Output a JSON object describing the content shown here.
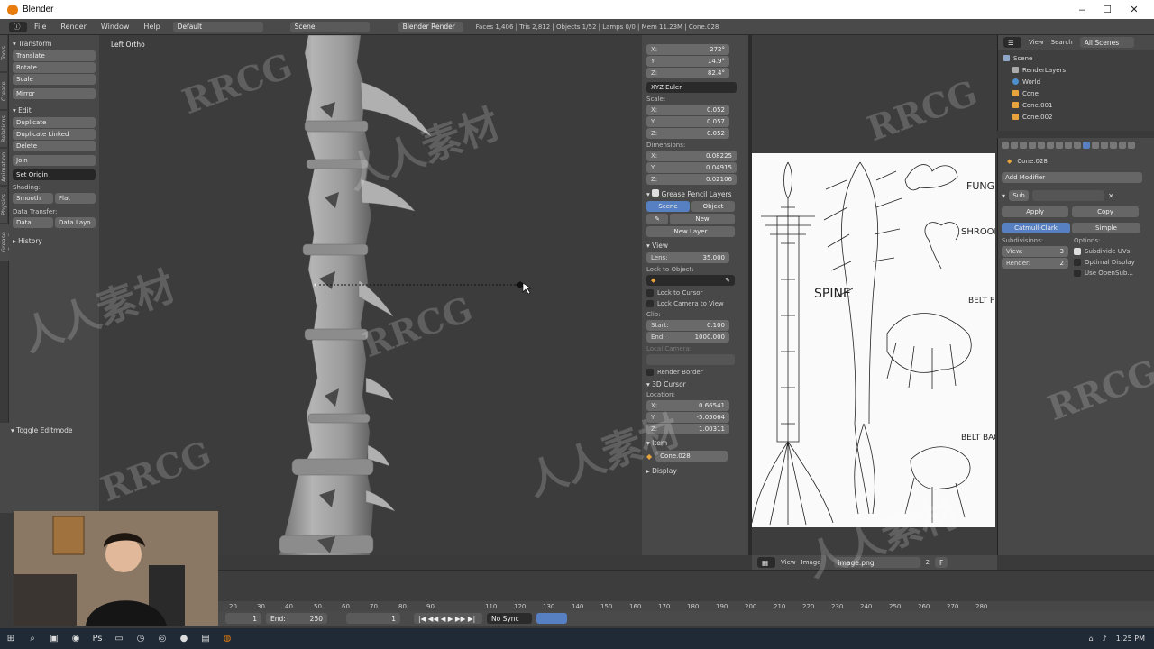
{
  "window": {
    "title": "Blender",
    "controls": [
      "–",
      "☐",
      "✕"
    ]
  },
  "menubar": {
    "items": [
      "File",
      "Render",
      "Window",
      "Help"
    ],
    "layout": "Default",
    "scene": "Scene",
    "engine": "Blender Render",
    "stats": "Faces 1,406 | Tris 2,812 | Objects 1/52 | Lamps 0/0 | Mem 11.23M | Cone.028"
  },
  "tool_tabs": [
    "Tools",
    "Create",
    "Relations",
    "Animation",
    "Physics",
    "Grease Pencil"
  ],
  "toolshelf": {
    "transform": {
      "header": "Transform",
      "buttons": [
        "Translate",
        "Rotate",
        "Scale",
        "Mirror"
      ]
    },
    "edit": {
      "header": "Edit",
      "buttons": [
        "Duplicate",
        "Duplicate Linked",
        "Delete",
        "Join"
      ],
      "set_origin": "Set Origin"
    },
    "shading": {
      "label": "Shading:",
      "smooth": "Smooth",
      "flat": "Flat"
    },
    "data_transfer": {
      "label": "Data Transfer:",
      "data": "Data",
      "data_layo": "Data Layo"
    },
    "history": "History"
  },
  "operator_panel": {
    "title": "Toggle Editmode"
  },
  "viewport": {
    "label": "Left Ortho"
  },
  "properties_panel": {
    "rotation": {
      "x": "272°",
      "y": "14.9°",
      "z": "82.4°",
      "mode": "XYZ Euler"
    },
    "scale": {
      "label": "Scale:",
      "x": "0.052",
      "y": "0.057",
      "z": "0.052"
    },
    "dimensions": {
      "label": "Dimensions:",
      "x": "0.08225",
      "y": "0.04915",
      "z": "0.02106"
    },
    "grease_pencil": {
      "header": "Grease Pencil Layers",
      "scene": "Scene",
      "object": "Object",
      "new": "New",
      "new_layer": "New Layer"
    },
    "view": {
      "header": "View",
      "lens_label": "Lens:",
      "lens": "35.000",
      "lock_obj": "Lock to Object:",
      "lock_cursor": "Lock to Cursor",
      "lock_camera": "Lock Camera to View",
      "clip": "Clip:",
      "start_label": "Start:",
      "start": "0.100",
      "end_label": "End:",
      "end": "1000.000",
      "local_camera": "Local Camera:",
      "render_border": "Render Border"
    },
    "cursor": {
      "header": "3D Cursor",
      "location": "Location:",
      "x": "0.66541",
      "y": "-5.05064",
      "z": "1.00311"
    },
    "item": {
      "header": "Item",
      "name": "Cone.028"
    },
    "display": "Display"
  },
  "image_editor": {
    "sketch_labels": [
      "SPINE",
      "FUNG",
      "SHROOM",
      "BELT FRONT",
      "BELT BACK"
    ],
    "header": {
      "view": "View",
      "image": "Image",
      "image_name": "image.png",
      "users": "2",
      "f": "F"
    }
  },
  "outliner": {
    "header": {
      "view": "View",
      "search": "Search",
      "filter": "All Scenes"
    },
    "rows": [
      "Scene",
      "RenderLayers",
      "World",
      "Cone",
      "Cone.001",
      "Cone.002"
    ]
  },
  "props_editor": {
    "object": "Cone.028",
    "add_modifier": "Add Modifier",
    "mod_name": "Sub",
    "apply": "Apply",
    "copy": "Copy",
    "catmull": "Catmull-Clark",
    "simple": "Simple",
    "subdivisions": "Subdivisions:",
    "options": "Options:",
    "view_label": "View:",
    "view": "3",
    "render_label": "Render:",
    "render": "2",
    "subdivide_uvs": "Subdivide UVs",
    "optimal_display": "Optimal Display",
    "use_opensub": "Use OpenSub..."
  },
  "timeline": {
    "ticks": [
      "20",
      "30",
      "40",
      "50",
      "60",
      "70",
      "80",
      "90",
      "110",
      "120",
      "130",
      "140",
      "150",
      "160",
      "170",
      "180",
      "190",
      "200",
      "210",
      "220",
      "230",
      "240",
      "250",
      "260",
      "270",
      "280"
    ],
    "start": "1",
    "end_label": "End:",
    "end": "250",
    "current": "1",
    "sync": "No Sync"
  },
  "taskbar": {
    "time": "1:25 PM"
  },
  "watermarks": [
    "RRCG",
    "人人素材",
    "RRCG",
    "人人素材",
    "RRCG",
    "RRCG",
    "人人素材",
    "RRCG",
    "人人素材"
  ],
  "colors": {
    "accent": "#5680c2",
    "blender_orange": "#e87d0d",
    "ui_bg": "#484848",
    "viewport": "#3c3c3c"
  }
}
